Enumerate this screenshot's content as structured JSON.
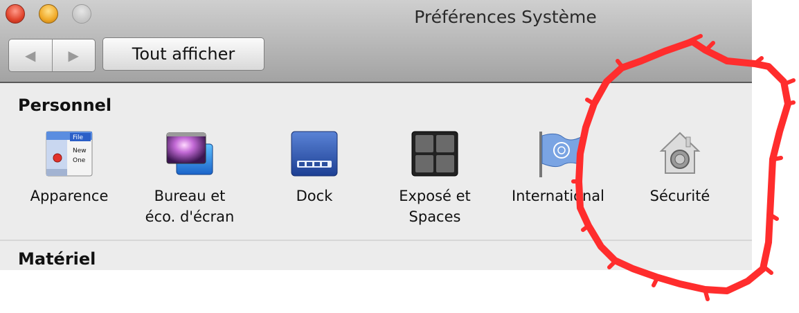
{
  "window": {
    "title": "Préférences Système",
    "show_all_label": "Tout afficher"
  },
  "sections": {
    "personal": "Personnel",
    "hardware": "Matériel"
  },
  "panes": [
    {
      "label": "Apparence",
      "icon": "appearance-icon"
    },
    {
      "label": "Bureau et\néco. d'écran",
      "icon": "desktop-screensaver-icon"
    },
    {
      "label": "Dock",
      "icon": "dock-icon"
    },
    {
      "label": "Exposé et\nSpaces",
      "icon": "expose-spaces-icon"
    },
    {
      "label": "International",
      "icon": "international-flag-icon"
    },
    {
      "label": "Sécurité",
      "icon": "security-house-icon"
    }
  ],
  "appearance_icon_text": {
    "line1": "File",
    "line2": "New",
    "line3": "One"
  },
  "annotation": {
    "type": "red freehand circle around Sécurité",
    "color": "#ff2d2d"
  }
}
